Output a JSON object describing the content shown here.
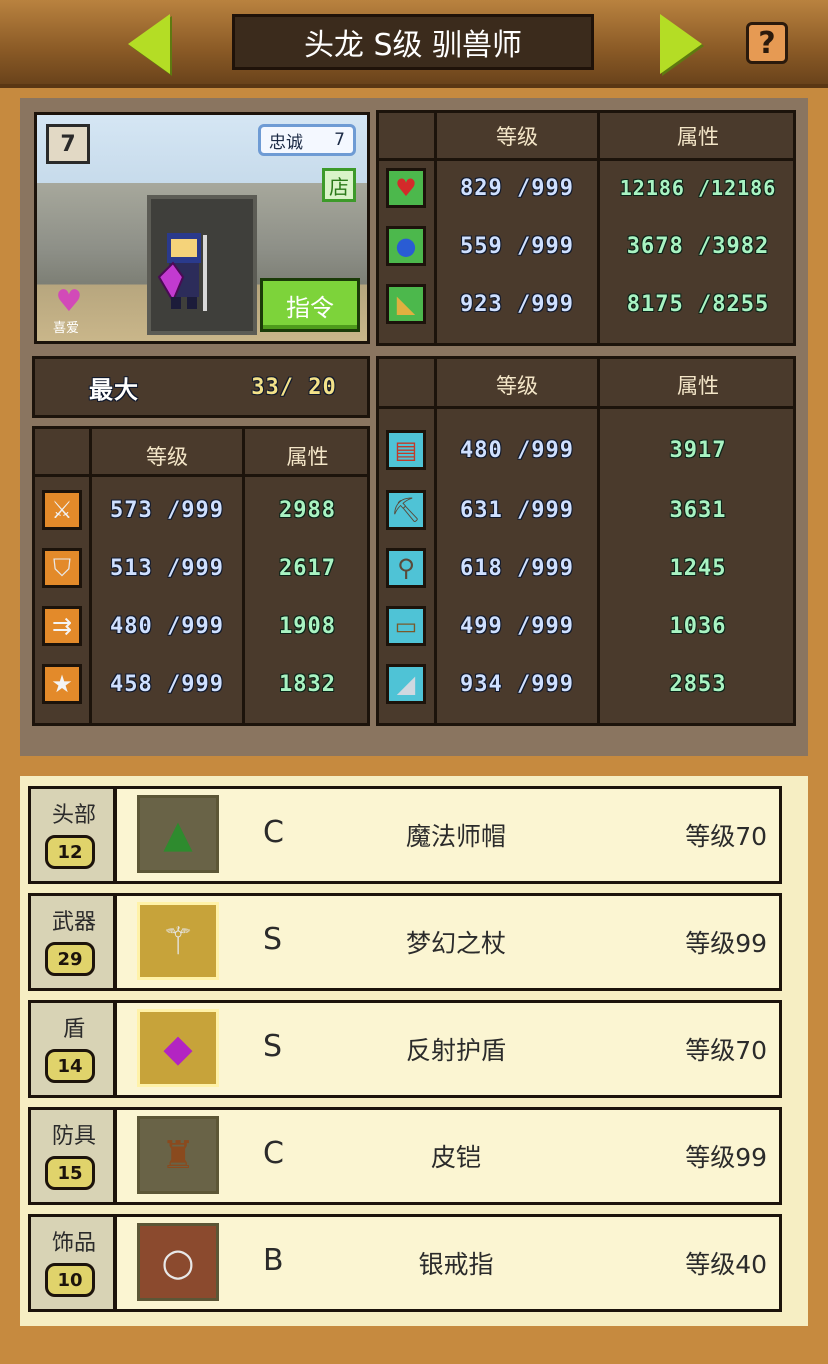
{
  "header": {
    "title": "头龙 S级 驯兽师",
    "help_label": "?"
  },
  "portrait": {
    "rank_badge": "7",
    "loyalty_label": "忠诚",
    "loyalty_value": "7",
    "shop_label": "店",
    "love_label": "喜爱",
    "command_label": "指令"
  },
  "vitals": {
    "headers": [
      "等级",
      "属性"
    ],
    "rows": [
      {
        "icon": "heart-icon",
        "level": "829 /999",
        "value": "12186 /12186"
      },
      {
        "icon": "mana-potion-icon",
        "level": "559 /999",
        "value": "3678 /3982"
      },
      {
        "icon": "stamina-arm-icon",
        "level": "923 /999",
        "value": "8175 /8255"
      }
    ]
  },
  "size": {
    "label": "最大",
    "value": "33/ 20"
  },
  "combat": {
    "headers": [
      "等级",
      "属性"
    ],
    "rows": [
      {
        "icon": "sword-icon",
        "level": "573 /999",
        "value": "2988"
      },
      {
        "icon": "shield-icon",
        "level": "513 /999",
        "value": "2617"
      },
      {
        "icon": "arrows-icon",
        "level": "480 /999",
        "value": "1908"
      },
      {
        "icon": "star-icon",
        "level": "458 /999",
        "value": "1832"
      }
    ]
  },
  "skills": {
    "headers": [
      "等级",
      "属性"
    ],
    "rows": [
      {
        "icon": "book-icon",
        "level": "480 /999",
        "value": "3917"
      },
      {
        "icon": "pickaxe-icon",
        "level": "631 /999",
        "value": "3631"
      },
      {
        "icon": "shovel-icon",
        "level": "618 /999",
        "value": "1245"
      },
      {
        "icon": "basket-icon",
        "level": "499 /999",
        "value": "1036"
      },
      {
        "icon": "boot-icon",
        "level": "934 /999",
        "value": "2853"
      }
    ]
  },
  "equipment": [
    {
      "slot": "头部",
      "slot_level": "12",
      "icon": "wizard-hat-icon",
      "grade": "C",
      "name": "魔法师帽",
      "level": "等级70"
    },
    {
      "slot": "武器",
      "slot_level": "29",
      "icon": "staff-icon",
      "grade": "S",
      "name": "梦幻之杖",
      "level": "等级99"
    },
    {
      "slot": "盾",
      "slot_level": "14",
      "icon": "gem-shield-icon",
      "grade": "S",
      "name": "反射护盾",
      "level": "等级70"
    },
    {
      "slot": "防具",
      "slot_level": "15",
      "icon": "leather-armor-icon",
      "grade": "C",
      "name": "皮铠",
      "level": "等级99"
    },
    {
      "slot": "饰品",
      "slot_level": "10",
      "icon": "silver-ring-icon",
      "grade": "B",
      "name": "银戒指",
      "level": "等级40"
    }
  ]
}
